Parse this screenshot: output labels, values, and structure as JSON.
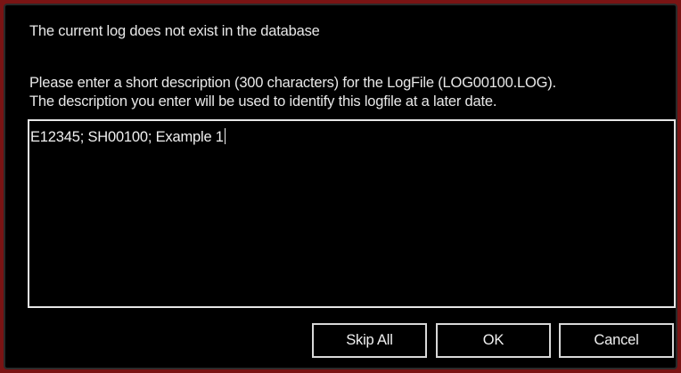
{
  "dialog": {
    "heading": "The current log does not exist in the database",
    "instruction_line1": "Please enter a short description (300 characters) for the LogFile (LOG00100.LOG).",
    "instruction_line2": "The description you enter will be used to identify this logfile at a later date.",
    "description_value": "E12345; SH00100; Example 1",
    "buttons": {
      "skip_all": "Skip All",
      "ok": "OK",
      "cancel": "Cancel"
    },
    "colors": {
      "background": "#000000",
      "frame": "#7a1414",
      "text": "#e8e8e8",
      "border": "#e6e6e6"
    }
  }
}
